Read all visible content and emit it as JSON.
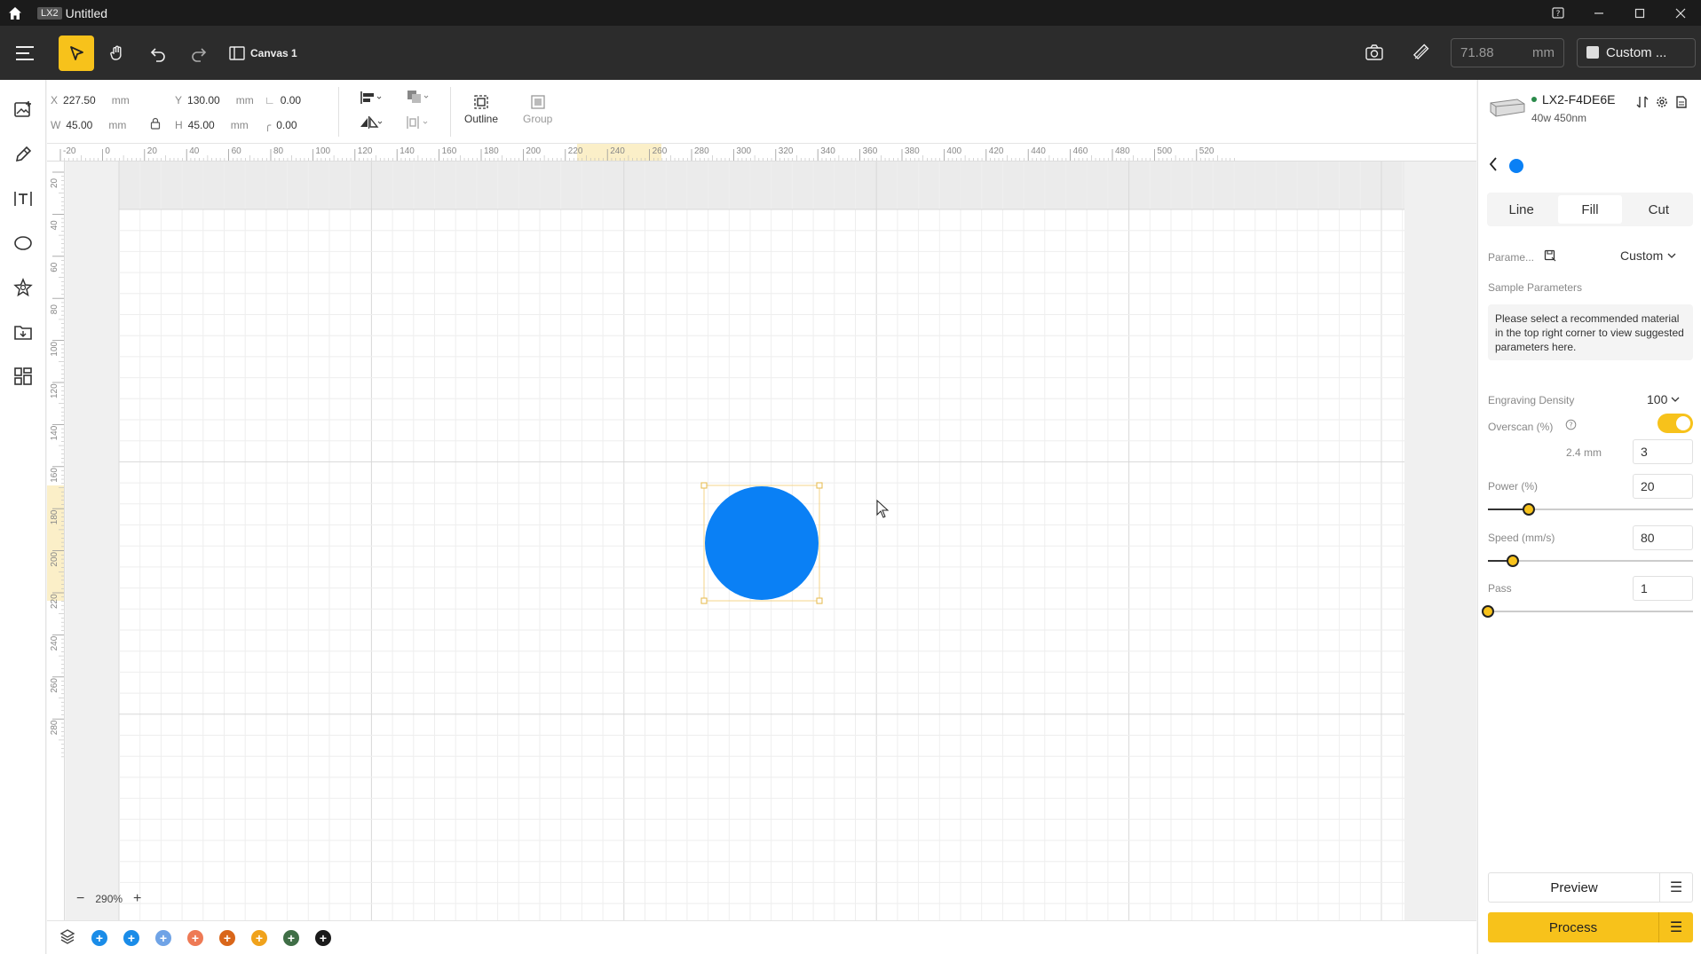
{
  "window": {
    "badge": "LX2",
    "title": "Untitled"
  },
  "toolbar": {
    "canvas_tab": "Canvas 1",
    "zoom_value": "71.88",
    "zoom_unit": "mm",
    "material_label": "Custom ..."
  },
  "properties": {
    "x_label": "X",
    "x_value": "227.50",
    "y_label": "Y",
    "y_value": "130.00",
    "w_label": "W",
    "w_value": "45.00",
    "h_label": "H",
    "h_value": "45.00",
    "unit": "mm",
    "angle_value": "0.00",
    "radius_value": "0.00",
    "outline_label": "Outline",
    "group_label": "Group"
  },
  "ruler": {
    "h_ticks": [
      "-20",
      "0",
      "20",
      "40",
      "60",
      "80",
      "100",
      "120",
      "140",
      "160",
      "180",
      "200",
      "220",
      "240",
      "260",
      "280",
      "300",
      "320",
      "340",
      "360",
      "380",
      "400",
      "420",
      "440",
      "460",
      "480",
      "500",
      "520"
    ],
    "v_ticks": [
      "20",
      "40",
      "60",
      "80",
      "100",
      "120",
      "140",
      "160",
      "180",
      "200",
      "220",
      "240",
      "260",
      "280"
    ]
  },
  "canvas": {
    "zoom_percent": "290%",
    "shape_color": "#0a80f5"
  },
  "layers": {
    "colors": [
      "#1a8ce8",
      "#1a8ce8",
      "#6fa3e6",
      "#ee7a55",
      "#d9661a",
      "#f0a21b",
      "#3f6e46",
      "#1b1b1b"
    ]
  },
  "panel": {
    "device_name": "LX2-F4DE6E",
    "device_sub": "40w 450nm",
    "tabs": [
      "Line",
      "Fill",
      "Cut"
    ],
    "active_tab": "Fill",
    "parameters_label": "Parame...",
    "parameters_value": "Custom",
    "sample_label": "Sample Parameters",
    "sample_note": "Please select a recommended material in the top right corner to view suggested parameters here.",
    "density_label": "Engraving Density",
    "density_value": "100",
    "overscan_label": "Overscan  (%)",
    "overscan_mm": "2.4 mm",
    "overscan_value": "3",
    "power_label": "Power  (%)",
    "power_value": "20",
    "power_level": 0.2,
    "speed_label": "Speed  (mm/s)",
    "speed_value": "80",
    "speed_level": 0.12,
    "pass_label": "Pass",
    "pass_value": "1",
    "pass_level": 0,
    "preview_label": "Preview",
    "process_label": "Process",
    "accent": "#f7c21b"
  }
}
